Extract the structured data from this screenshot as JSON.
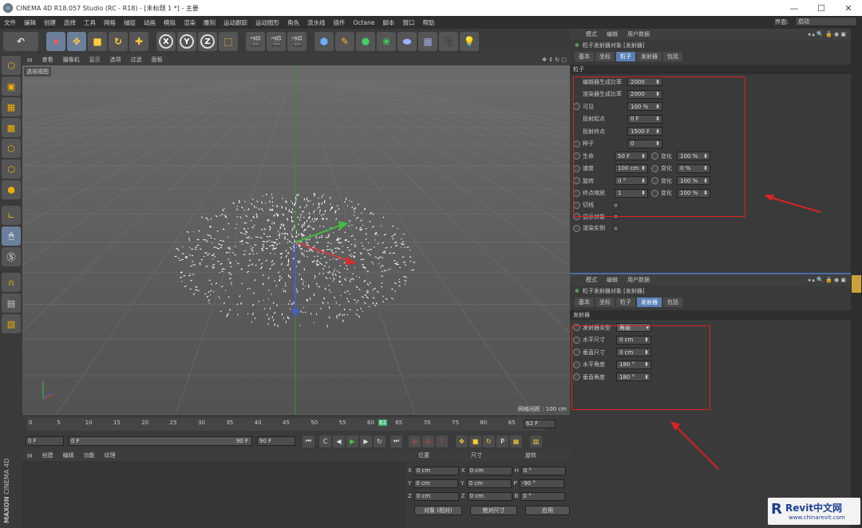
{
  "titlebar": {
    "title": "CINEMA 4D R18.057 Studio (RC - R18) - [未标题 1 *] - 主要",
    "controls": [
      "—",
      "☐",
      "✕"
    ]
  },
  "menubar": {
    "items": [
      "文件",
      "编辑",
      "创建",
      "选择",
      "工具",
      "网格",
      "捕捉",
      "动画",
      "模拟",
      "渲染",
      "雕刻",
      "运动跟踪",
      "运动图形",
      "角色",
      "流水线",
      "插件",
      "Octane",
      "脚本",
      "窗口",
      "帮助"
    ],
    "layout_label": "界面:",
    "layout_value": "启动"
  },
  "toolbar": {
    "axis": [
      "X",
      "Y",
      "Z"
    ]
  },
  "viewport": {
    "menu": [
      "查看",
      "摄像机",
      "显示",
      "选项",
      "过滤",
      "面板"
    ],
    "label": "透视视图",
    "grid_spacing": "网格间距 : 100 cm"
  },
  "timeline": {
    "ticks": [
      "0",
      "5",
      "10",
      "15",
      "20",
      "25",
      "30",
      "35",
      "40",
      "45",
      "50",
      "55",
      "60",
      "62",
      "65",
      "70",
      "75",
      "80",
      "85",
      "90"
    ],
    "current_frame": "62 F"
  },
  "transport": {
    "start": "0 F",
    "range_start": "0 F",
    "range_end": "90 F",
    "end": "90 F"
  },
  "material": {
    "menu": [
      "创建",
      "编辑",
      "功能",
      "纹理"
    ]
  },
  "coords": {
    "headers": [
      "位置",
      "尺寸",
      "旋转"
    ],
    "rows": [
      {
        "a": "X",
        "pos": "0 cm",
        "b": "X",
        "size": "0 cm",
        "c": "H",
        "rot": "0 °"
      },
      {
        "a": "Y",
        "pos": "0 cm",
        "b": "Y",
        "size": "0 cm",
        "c": "P",
        "rot": "-90 °"
      },
      {
        "a": "Z",
        "pos": "0 cm",
        "b": "Z",
        "size": "0 cm",
        "c": "B",
        "rot": "0 °"
      }
    ],
    "mode": "对象 (相对)",
    "size_mode": "绝对尺寸",
    "apply": "应用"
  },
  "attr1": {
    "menu": [
      "模式",
      "编辑",
      "用户数据"
    ],
    "object": "粒子发射器对象 [发射器]",
    "tabs": [
      "基本",
      "坐标",
      "粒子",
      "发射器",
      "包括"
    ],
    "active_tab": 2,
    "section": "粒子",
    "rows": [
      {
        "label": "编辑器生成比率",
        "value": "2000",
        "radio": false
      },
      {
        "label": "渲染器生成比率",
        "value": "2000",
        "radio": false
      },
      {
        "label": "可见",
        "value": "100 %",
        "radio": true
      },
      {
        "label": "投射起点",
        "value": "0 F",
        "radio": false
      },
      {
        "label": "投射终点",
        "value": "1500 F",
        "radio": false
      },
      {
        "label": "种子",
        "value": "0",
        "radio": true
      }
    ],
    "pairs": [
      {
        "label": "生命",
        "value": "50 F",
        "vlabel": "变化",
        "vvalue": "100 %"
      },
      {
        "label": "速度",
        "value": "100 cm",
        "vlabel": "变化",
        "vvalue": "0 %"
      },
      {
        "label": "旋转",
        "value": "0 °",
        "vlabel": "变化",
        "vvalue": "100 %"
      },
      {
        "label": "终点缩放",
        "value": "1",
        "vlabel": "变化",
        "vvalue": "100 %"
      }
    ],
    "checks": [
      {
        "label": "切线"
      },
      {
        "label": "显示对象"
      },
      {
        "label": "渲染实例"
      }
    ]
  },
  "attr2": {
    "menu": [
      "模式",
      "编辑",
      "用户数据"
    ],
    "object": "粒子发射器对象 [发射器]",
    "tabs": [
      "基本",
      "坐标",
      "粒子",
      "发射器",
      "包括"
    ],
    "active_tab": 3,
    "section": "发射器",
    "rows": [
      {
        "label": "发射器类型",
        "value": "角锥"
      },
      {
        "label": "水平尺寸",
        "value": "0 cm"
      },
      {
        "label": "垂直尺寸",
        "value": "0 cm"
      },
      {
        "label": "水平角度",
        "value": "180 °"
      },
      {
        "label": "垂直角度",
        "value": "180 °"
      }
    ]
  },
  "branding": {
    "maxon": "MAXON",
    "c4d": "CINEMA 4D",
    "logo": "Revit中文网",
    "url": "www.chinarevit.com"
  },
  "colors": {
    "accent": "#5a7fb6",
    "annotation": "#dd2222",
    "x_axis": "#c84040",
    "y_axis": "#40c040",
    "z_axis": "#4060d0"
  }
}
